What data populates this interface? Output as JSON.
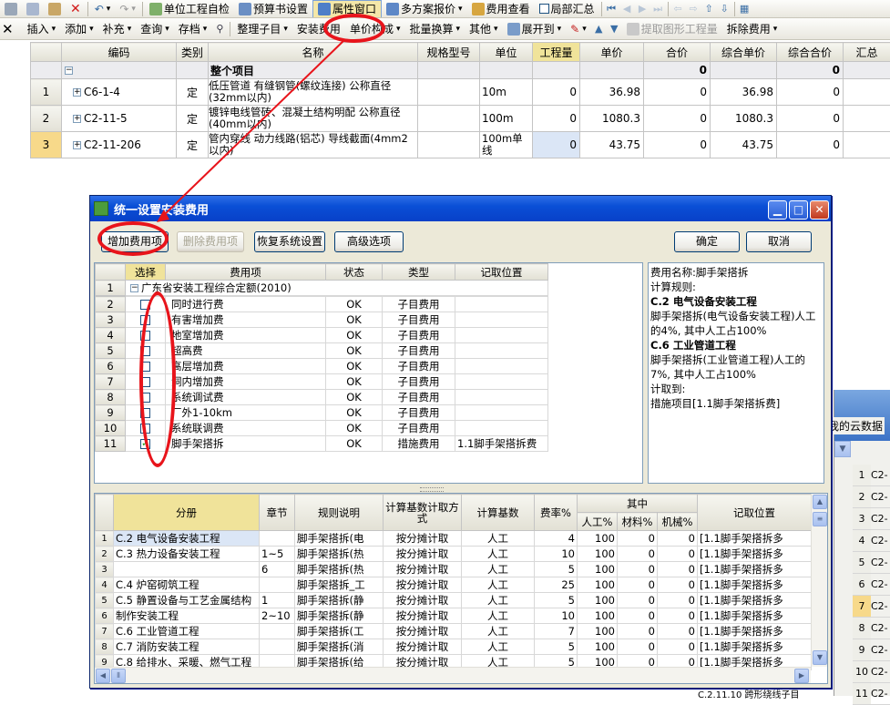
{
  "toolbar1": {
    "items": [
      "单位工程自检",
      "预算书设置",
      "属性窗口",
      "多方案报价",
      "费用查看",
      "局部汇总"
    ]
  },
  "toolbar2": {
    "items": [
      "插入",
      "添加",
      "补充",
      "查询",
      "存档",
      "整理子目",
      "安装费用",
      "单价构成",
      "批量换算",
      "其他",
      "展开到",
      "提取图形工程量",
      "拆除费用"
    ]
  },
  "main_grid": {
    "headers": [
      "编码",
      "类别",
      "名称",
      "规格型号",
      "单位",
      "工程量",
      "单价",
      "合价",
      "综合单价",
      "综合合价",
      "汇总"
    ],
    "top_row": {
      "name": "整个项目",
      "total": "0",
      "comp_total": "0"
    },
    "rows": [
      {
        "num": "1",
        "code": "C6-1-4",
        "type": "定",
        "name": "低压管道 有缝钢管(螺纹连接) 公称直径(32mm以内)",
        "unit": "10m",
        "qty": "0",
        "price": "36.98",
        "total": "0",
        "comp_price": "36.98",
        "comp_total": "0"
      },
      {
        "num": "2",
        "code": "C2-11-5",
        "type": "定",
        "name": "镀锌电线管砖、混凝土结构明配 公称直径(40mm以内)",
        "unit": "100m",
        "qty": "0",
        "price": "1080.3",
        "total": "0",
        "comp_price": "1080.3",
        "comp_total": "0"
      },
      {
        "num": "3",
        "code": "C2-11-206",
        "type": "定",
        "name": "管内穿线 动力线路(铝芯) 导线截面(4mm2以内)",
        "unit": "100m单线",
        "qty": "0",
        "price": "43.75",
        "total": "0",
        "comp_price": "43.75",
        "comp_total": "0"
      }
    ]
  },
  "dialog": {
    "title": "统一设置安装费用",
    "buttons": {
      "add": "增加费用项",
      "delete": "删除费用项",
      "restore": "恢复系统设置",
      "advanced": "高级选项",
      "ok": "确定",
      "cancel": "取消"
    },
    "fee_headers": [
      "选择",
      "费用项",
      "状态",
      "类型",
      "记取位置"
    ],
    "fee_group": {
      "num": "1",
      "name": "广东省安装工程综合定额(2010)"
    },
    "fee_rows": [
      {
        "num": "2",
        "checked": false,
        "name": "同时进行费",
        "status": "OK",
        "type": "子目费用",
        "pos": ""
      },
      {
        "num": "3",
        "checked": false,
        "name": "有害增加费",
        "status": "OK",
        "type": "子目费用",
        "pos": ""
      },
      {
        "num": "4",
        "checked": false,
        "name": "地室增加费",
        "status": "OK",
        "type": "子目费用",
        "pos": ""
      },
      {
        "num": "5",
        "checked": false,
        "name": "超高费",
        "status": "OK",
        "type": "子目费用",
        "pos": ""
      },
      {
        "num": "6",
        "checked": false,
        "name": "高层增加费",
        "status": "OK",
        "type": "子目费用",
        "pos": ""
      },
      {
        "num": "7",
        "checked": false,
        "name": "洞内增加费",
        "status": "OK",
        "type": "子目费用",
        "pos": ""
      },
      {
        "num": "8",
        "checked": false,
        "name": "系统调试费",
        "status": "OK",
        "type": "子目费用",
        "pos": ""
      },
      {
        "num": "9",
        "checked": false,
        "name": "厂外1-10km",
        "status": "OK",
        "type": "子目费用",
        "pos": ""
      },
      {
        "num": "10",
        "checked": false,
        "name": "系统联调费",
        "status": "OK",
        "type": "子目费用",
        "pos": ""
      },
      {
        "num": "11",
        "checked": true,
        "name": "脚手架搭拆",
        "status": "OK",
        "type": "措施费用",
        "pos": "1.1脚手架搭拆费"
      }
    ],
    "description": [
      {
        "text": "费用名称:脚手架搭拆",
        "bold": false
      },
      {
        "text": "计算规则:",
        "bold": false
      },
      {
        "text": "C.2 电气设备安装工程",
        "bold": true
      },
      {
        "text": "脚手架搭拆(电气设备安装工程)人工的4%, 其中人工占100%",
        "bold": false
      },
      {
        "text": "C.6 工业管道工程",
        "bold": true
      },
      {
        "text": "脚手架搭拆(工业管道工程)人工的7%, 其中人工占100%",
        "bold": false
      },
      {
        "text": "计取到:",
        "bold": false
      },
      {
        "text": "措施项目[1.1脚手架搭拆费]",
        "bold": false
      }
    ],
    "bottom_headers": [
      "分册",
      "章节",
      "规则说明",
      "计算基数计取方式",
      "计算基数",
      "费率%",
      "其中",
      "人工%",
      "材料%",
      "机械%",
      "记取位置"
    ],
    "bottom_rows": [
      {
        "num": "1",
        "cat": "C.2 电气设备安装工程",
        "sec": "",
        "rule": "脚手架搭拆(电",
        "method": "按分摊计取",
        "base": "人工",
        "rate": "4",
        "lab": "100",
        "mat": "0",
        "mach": "0",
        "pos": "[1.1脚手架搭拆多"
      },
      {
        "num": "2",
        "cat": "C.3 热力设备安装工程",
        "sec": "1~5",
        "rule": "脚手架搭拆(热",
        "method": "按分摊计取",
        "base": "人工",
        "rate": "10",
        "lab": "100",
        "mat": "0",
        "mach": "0",
        "pos": "[1.1脚手架搭拆多"
      },
      {
        "num": "3",
        "cat": "",
        "sec": "6",
        "rule": "脚手架搭拆(热",
        "method": "按分摊计取",
        "base": "人工",
        "rate": "5",
        "lab": "100",
        "mat": "0",
        "mach": "0",
        "pos": "[1.1脚手架搭拆多"
      },
      {
        "num": "4",
        "cat": "C.4 炉窑砌筑工程",
        "sec": "",
        "rule": "脚手架搭拆_工",
        "method": "按分摊计取",
        "base": "人工",
        "rate": "25",
        "lab": "100",
        "mat": "0",
        "mach": "0",
        "pos": "[1.1脚手架搭拆多"
      },
      {
        "num": "5",
        "cat": "C.5 静置设备与工艺金属结构",
        "sec": "1",
        "rule": "脚手架搭拆(静",
        "method": "按分摊计取",
        "base": "人工",
        "rate": "5",
        "lab": "100",
        "mat": "0",
        "mach": "0",
        "pos": "[1.1脚手架搭拆多"
      },
      {
        "num": "6",
        "cat": "制作安装工程",
        "sec": "2~10",
        "rule": "脚手架搭拆(静",
        "method": "按分摊计取",
        "base": "人工",
        "rate": "10",
        "lab": "100",
        "mat": "0",
        "mach": "0",
        "pos": "[1.1脚手架搭拆多"
      },
      {
        "num": "7",
        "cat": "C.6 工业管道工程",
        "sec": "",
        "rule": "脚手架搭拆(工",
        "method": "按分摊计取",
        "base": "人工",
        "rate": "7",
        "lab": "100",
        "mat": "0",
        "mach": "0",
        "pos": "[1.1脚手架搭拆多"
      },
      {
        "num": "8",
        "cat": "C.7 消防安装工程",
        "sec": "",
        "rule": "脚手架搭拆(消",
        "method": "按分摊计取",
        "base": "人工",
        "rate": "5",
        "lab": "100",
        "mat": "0",
        "mach": "0",
        "pos": "[1.1脚手架搭拆多"
      },
      {
        "num": "9",
        "cat": "C.8 给排水、采暖、燃气工程",
        "sec": "",
        "rule": "脚手架搭拆(给",
        "method": "按分摊计取",
        "base": "人工",
        "rate": "5",
        "lab": "100",
        "mat": "0",
        "mach": "0",
        "pos": "[1.1脚手架搭拆多"
      }
    ]
  },
  "bg_window": {
    "text": "我的云数据",
    "codes": [
      "C2-",
      "C2-",
      "C2-",
      "C2-",
      "C2-",
      "C2-",
      "C2-",
      "C2-",
      "C2-",
      "C2-",
      "C2-"
    ],
    "nums": [
      "1",
      "2",
      "3",
      "4",
      "5",
      "6",
      "7",
      "8",
      "9",
      "10",
      "11"
    ],
    "footer": "C.2.11.10 跨形绕线子目"
  },
  "colors": {
    "accent": "#0a4fd6",
    "annotation": "#e8141b",
    "highlight": "#f0e39a",
    "checked": "#21a121"
  }
}
